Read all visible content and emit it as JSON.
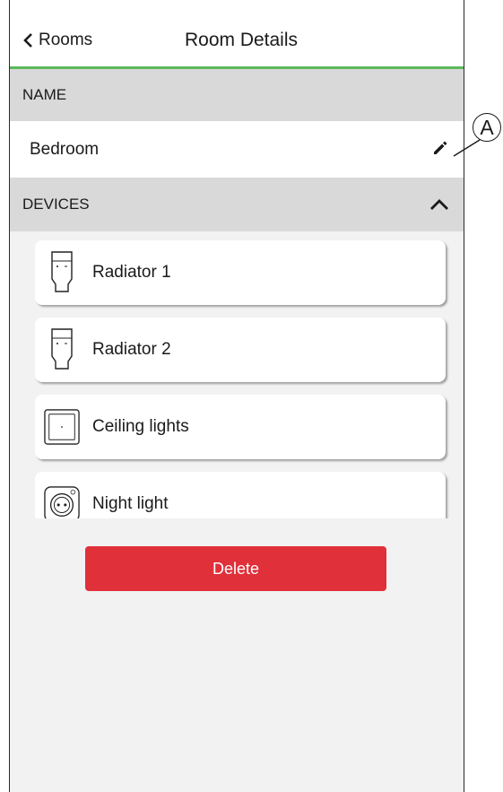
{
  "header": {
    "back_label": "Rooms",
    "title": "Room Details"
  },
  "name_section": {
    "header": "NAME",
    "value": "Bedroom"
  },
  "devices_section": {
    "header": "DEVICES",
    "items": [
      {
        "label": "Radiator 1",
        "icon": "radiator-thermostat-icon"
      },
      {
        "label": "Radiator 2",
        "icon": "radiator-thermostat-icon"
      },
      {
        "label": "Ceiling lights",
        "icon": "light-switch-icon"
      },
      {
        "label": "Night light",
        "icon": "smart-socket-icon"
      }
    ]
  },
  "actions": {
    "delete_label": "Delete"
  },
  "annotation": {
    "callout_label": "A"
  },
  "colors": {
    "accent_line": "#5cb85c",
    "delete_button": "#e0303a",
    "section_header": "#d9d9d9"
  }
}
